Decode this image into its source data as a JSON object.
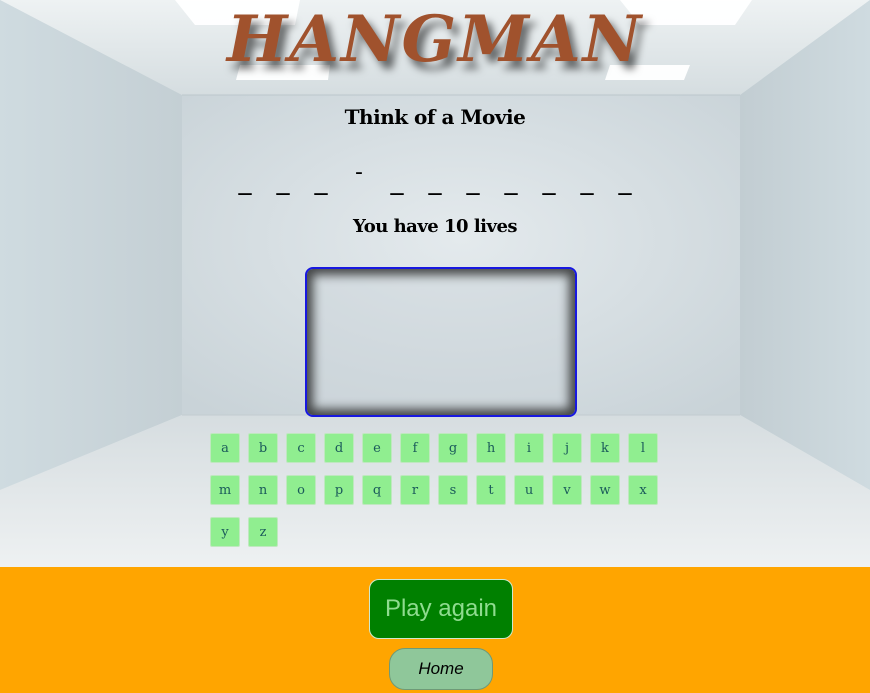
{
  "title": "HANGMAN",
  "category_prompt": "Think of a Movie",
  "word_slots": [
    "_",
    "_",
    "_",
    "-",
    "_",
    "_",
    "_",
    "_",
    "_",
    "_",
    "_"
  ],
  "lives_text": "You have 10 lives",
  "letters": [
    "a",
    "b",
    "c",
    "d",
    "e",
    "f",
    "g",
    "h",
    "i",
    "j",
    "k",
    "l",
    "m",
    "n",
    "o",
    "p",
    "q",
    "r",
    "s",
    "t",
    "u",
    "v",
    "w",
    "x",
    "y",
    "z"
  ],
  "buttons": {
    "play_again": "Play again",
    "home": "Home"
  },
  "colors": {
    "title": "#a0522d",
    "footer": "#ffa500",
    "letter_key": "#90ee90",
    "play_again": "#008000",
    "home": "#8fc79a",
    "canvas_border": "#1818e0"
  }
}
